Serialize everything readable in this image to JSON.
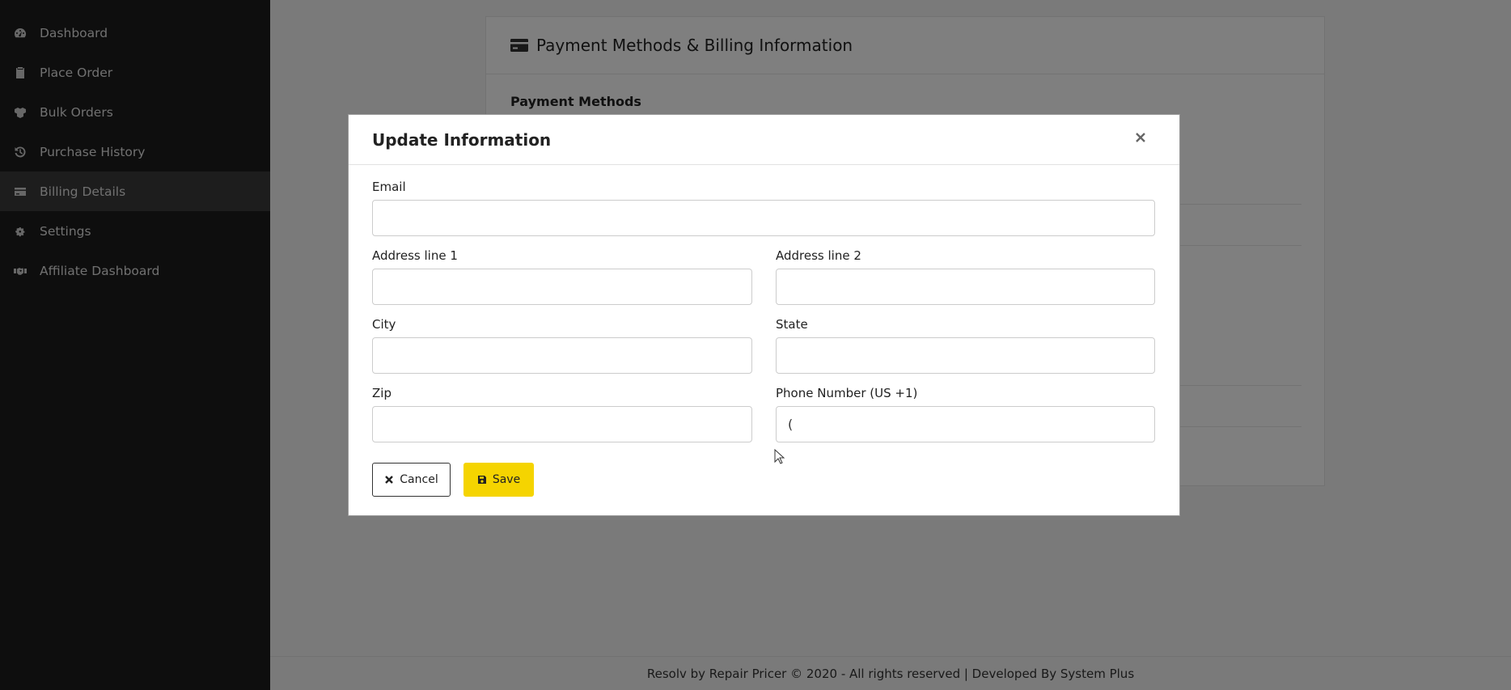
{
  "sidebar": {
    "items": [
      {
        "label": "Dashboard",
        "icon": "gauge-icon"
      },
      {
        "label": "Place Order",
        "icon": "clipboard-icon"
      },
      {
        "label": "Bulk Orders",
        "icon": "boxes-icon"
      },
      {
        "label": "Purchase History",
        "icon": "history-icon"
      },
      {
        "label": "Billing Details",
        "icon": "credit-card-icon",
        "active": true
      },
      {
        "label": "Settings",
        "icon": "gears-icon"
      },
      {
        "label": "Affiliate Dashboard",
        "icon": "handshake-icon"
      }
    ]
  },
  "card": {
    "title": "Payment Methods & Billing Information",
    "subtitle": "Payment Methods"
  },
  "footer": {
    "text": "Resolv by Repair Pricer © 2020 - All rights reserved | Developed By System Plus"
  },
  "modal": {
    "title": "Update Information",
    "fields": {
      "email": {
        "label": "Email",
        "value": ""
      },
      "address1": {
        "label": "Address line 1",
        "value": ""
      },
      "address2": {
        "label": "Address line 2",
        "value": ""
      },
      "city": {
        "label": "City",
        "value": ""
      },
      "state": {
        "label": "State",
        "value": ""
      },
      "zip": {
        "label": "Zip",
        "value": ""
      },
      "phone": {
        "label": "Phone Number (US +1)",
        "value": "("
      }
    },
    "cancel_label": "Cancel",
    "save_label": "Save"
  },
  "colors": {
    "sidebar_bg": "#1c1c1c",
    "save_button": "#f5d400",
    "overlay": "rgba(0,0,0,0.5)"
  }
}
